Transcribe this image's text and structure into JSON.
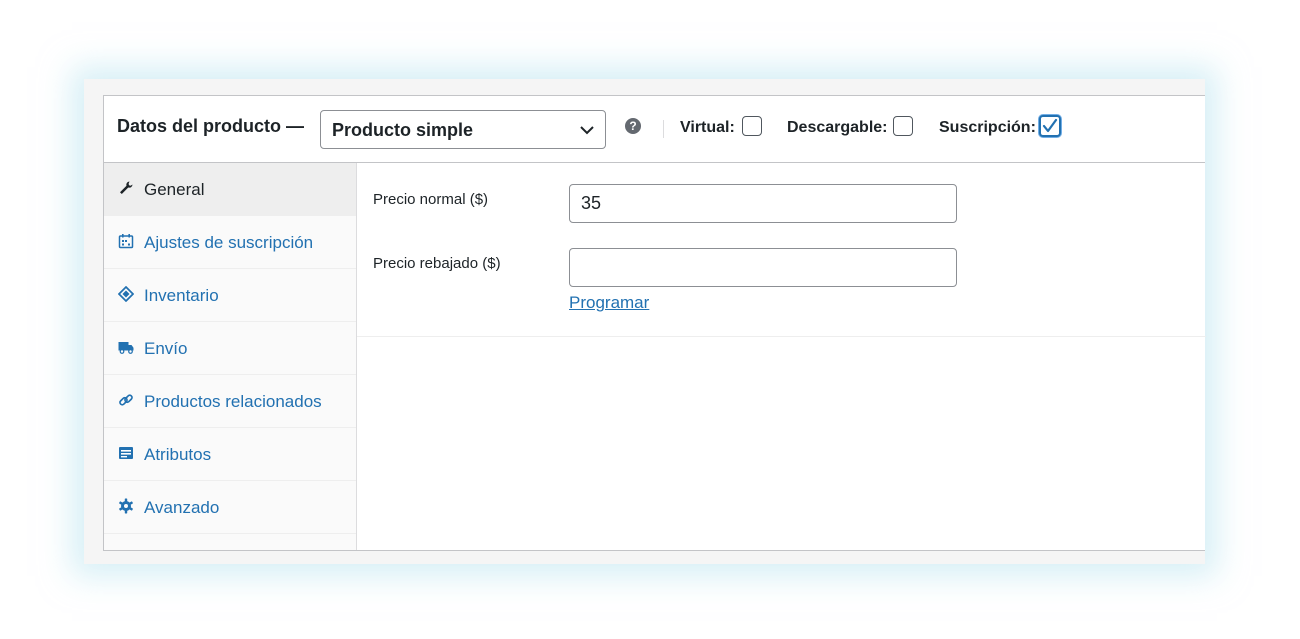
{
  "header": {
    "title": "Datos del producto —",
    "product_type": {
      "selected": "Producto simple"
    },
    "help_icon": "question-icon",
    "checkboxes": [
      {
        "label": "Virtual:",
        "checked": false
      },
      {
        "label": "Descargable:",
        "checked": false
      },
      {
        "label": "Suscripción:",
        "checked": true
      }
    ]
  },
  "sidebar": {
    "items": [
      {
        "label": "General",
        "icon": "wrench-icon",
        "active": true
      },
      {
        "label": "Ajustes de suscripción",
        "icon": "calendar-icon",
        "active": false
      },
      {
        "label": "Inventario",
        "icon": "tag-icon",
        "active": false
      },
      {
        "label": "Envío",
        "icon": "truck-icon",
        "active": false
      },
      {
        "label": "Productos relacionados",
        "icon": "link-icon",
        "active": false
      },
      {
        "label": "Atributos",
        "icon": "list-card-icon",
        "active": false
      },
      {
        "label": "Avanzado",
        "icon": "gear-icon",
        "active": false
      }
    ]
  },
  "general": {
    "regular_price": {
      "label": "Precio normal ($)",
      "value": "35"
    },
    "sale_price": {
      "label": "Precio rebajado ($)",
      "value": ""
    },
    "schedule_link": "Programar"
  },
  "colors": {
    "accent": "#2271b1",
    "text": "#1d2327",
    "border": "#c3c4c7"
  }
}
